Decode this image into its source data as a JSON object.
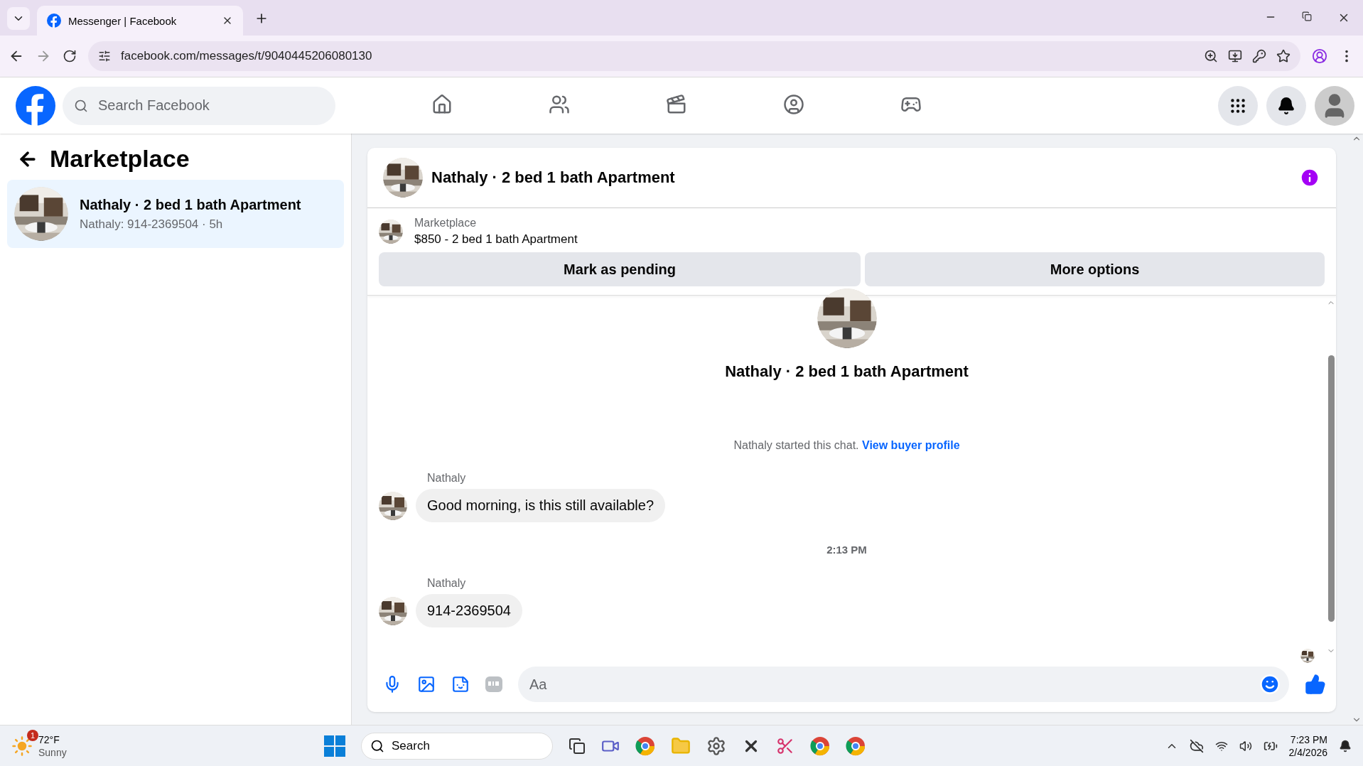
{
  "browser": {
    "tabs": [
      {
        "title": "Messenger | Facebook",
        "selected": true
      }
    ],
    "url": "facebook.com/messages/t/9040445206080130"
  },
  "header": {
    "search": {
      "placeholder": "Search Facebook"
    },
    "nav": [
      {
        "kind": "home",
        "selected": false
      },
      {
        "kind": "friends",
        "selected": false
      },
      {
        "kind": "video",
        "selected": false
      },
      {
        "kind": "groups",
        "selected": false
      },
      {
        "kind": "gaming",
        "selected": false
      }
    ]
  },
  "sidebar": {
    "title": "Marketplace",
    "conversations": [
      {
        "title": "Nathaly · 2 bed 1 bath Apartment",
        "preview": "Nathaly: 914-2369504 · 5h",
        "selected": true
      }
    ]
  },
  "chat": {
    "title": "Nathaly · 2 bed 1 bath Apartment",
    "listing": {
      "label": "Marketplace",
      "title": "$850 - 2 bed 1 bath Apartment"
    },
    "actions": [
      "Mark as pending",
      "More options"
    ],
    "intro_title": "Nathaly · 2 bed 1 bath Apartment",
    "items": [
      {
        "kind": "system",
        "text": "Nathaly started this chat.",
        "link": "View buyer profile"
      },
      {
        "kind": "message",
        "sender": "Nathaly",
        "text": "Good morning, is this still available?"
      },
      {
        "kind": "timestamp",
        "text": "2:13 PM"
      },
      {
        "kind": "message",
        "sender": "Nathaly",
        "text": "914-2369504"
      }
    ],
    "composer": {
      "placeholder": "Aa"
    }
  },
  "taskbar": {
    "weather": {
      "badge": "1",
      "temp": "72°F",
      "condition": "Sunny"
    },
    "search": "Search",
    "time": "7:23 PM",
    "date": "2/4/2026"
  }
}
